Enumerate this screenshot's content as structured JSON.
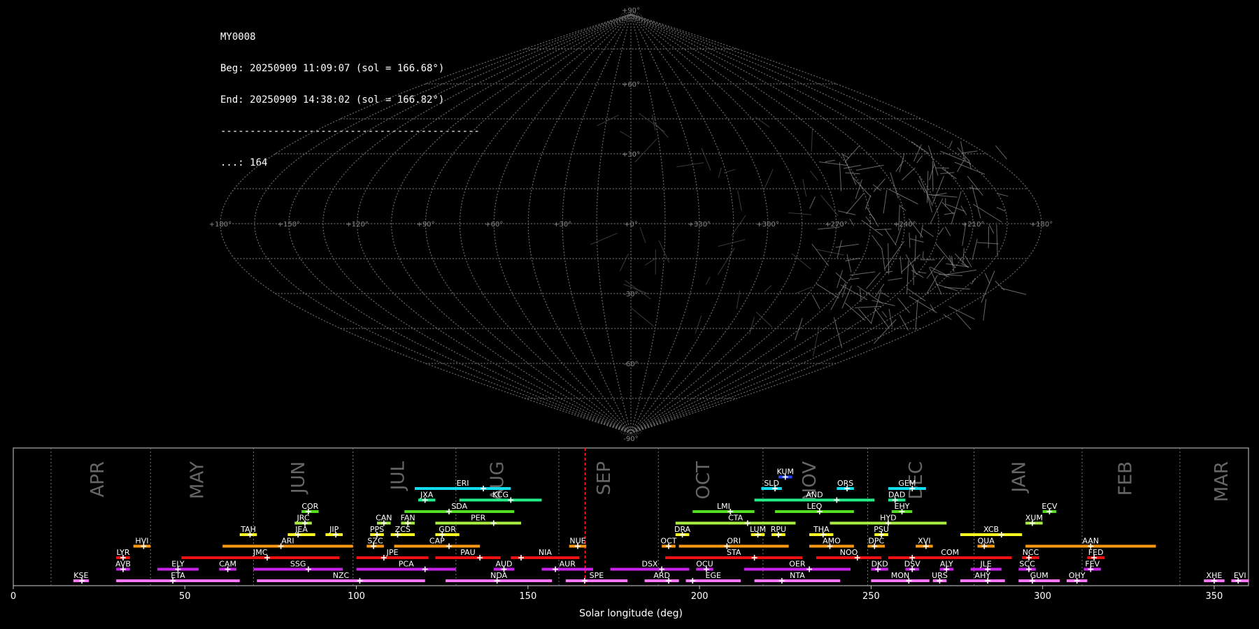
{
  "header": {
    "id_line": "MY0008",
    "begin_line": "Beg: 20250909 11:09:07 (sol = 166.68°)",
    "end_line": "End: 20250909 14:38:02 (sol = 166.82°)",
    "separator": "--------------------------------------------",
    "count_line": "...: 164"
  },
  "chart_data": [
    {
      "type": "scatter",
      "projection": "sinusoidal (all-sky)",
      "grid": true,
      "longitude_labels": [
        "+180°",
        "+150°",
        "+120°",
        "+90°",
        "+60°",
        "+30°",
        "+0°",
        "+330°",
        "+300°",
        "+270°",
        "+240°",
        "+210°",
        "+180°"
      ],
      "latitude_labels": [
        "+90°",
        "+60°",
        "+30°",
        "-30°",
        "-60°",
        "-90°"
      ],
      "description_of_marks": "short meteor trails concentrated around longitude 270°–210°",
      "colors": {
        "grid": "#666666",
        "trails": "#8a8a8a"
      }
    },
    {
      "type": "bar",
      "title": "",
      "xlabel": "Solar longitude (deg)",
      "xlim": [
        0,
        360
      ],
      "x_ticks": [
        0,
        50,
        100,
        150,
        200,
        250,
        300,
        350
      ],
      "current_sol": 166.68,
      "month_labels": [
        {
          "name": "APR",
          "sol": 24.5
        },
        {
          "name": "MAY",
          "sol": 53.5
        },
        {
          "name": "JUN",
          "sol": 83
        },
        {
          "name": "JUL",
          "sol": 112
        },
        {
          "name": "AUG",
          "sol": 141
        },
        {
          "name": "SEP",
          "sol": 172
        },
        {
          "name": "OCT",
          "sol": 201
        },
        {
          "name": "NOV",
          "sol": 232
        },
        {
          "name": "DEC",
          "sol": 263
        },
        {
          "name": "JAN",
          "sol": 293
        },
        {
          "name": "FEB",
          "sol": 324
        },
        {
          "name": "MAR",
          "sol": 352
        }
      ],
      "month_boundaries": [
        11,
        40,
        70,
        99,
        129,
        159,
        188,
        218.5,
        249,
        280,
        311.5,
        340
      ],
      "level_colors": [
        "#ff77ff",
        "#cc22ee",
        "#ee1111",
        "#ff9911",
        "#ffff22",
        "#aaee44",
        "#55dd22",
        "#22ee88",
        "#11ddee",
        "#2244ff"
      ],
      "showers": [
        {
          "code": "KSE",
          "start": 17.5,
          "end": 22,
          "peak": 20,
          "level": 0
        },
        {
          "code": "ETA",
          "start": 30,
          "end": 66,
          "peak": 46.5,
          "level": 0
        },
        {
          "code": "NZC",
          "start": 71,
          "end": 120,
          "peak": 101,
          "level": 0
        },
        {
          "code": "NDA",
          "start": 126,
          "end": 157,
          "peak": 141,
          "level": 0
        },
        {
          "code": "SPE",
          "start": 161,
          "end": 179,
          "peak": 166.5,
          "level": 0
        },
        {
          "code": "ARD",
          "start": 184,
          "end": 194,
          "peak": 191,
          "level": 0
        },
        {
          "code": "EGE",
          "start": 196,
          "end": 212,
          "peak": 198,
          "level": 0
        },
        {
          "code": "NTA",
          "start": 216,
          "end": 241,
          "peak": 224,
          "level": 0
        },
        {
          "code": "MON",
          "start": 250,
          "end": 267,
          "peak": 261,
          "level": 0
        },
        {
          "code": "URS",
          "start": 268,
          "end": 272,
          "peak": 270,
          "level": 0
        },
        {
          "code": "AHY",
          "start": 276,
          "end": 289,
          "peak": 284,
          "level": 0
        },
        {
          "code": "GUM",
          "start": 293,
          "end": 305,
          "peak": 297,
          "level": 0
        },
        {
          "code": "OHY",
          "start": 307,
          "end": 313,
          "peak": 310,
          "level": 0
        },
        {
          "code": "XHE",
          "start": 347,
          "end": 353,
          "peak": 350,
          "level": 0
        },
        {
          "code": "EVI",
          "start": 355,
          "end": 360,
          "peak": 357,
          "level": 0
        },
        {
          "code": "AVB",
          "start": 30,
          "end": 34,
          "peak": 32,
          "level": 1
        },
        {
          "code": "ELY",
          "start": 42,
          "end": 54,
          "peak": 48,
          "level": 1
        },
        {
          "code": "CAM",
          "start": 60,
          "end": 65,
          "peak": 62.5,
          "level": 1
        },
        {
          "code": "SSG",
          "start": 70,
          "end": 96,
          "peak": 86,
          "level": 1
        },
        {
          "code": "PCA",
          "start": 100,
          "end": 129,
          "peak": 120,
          "level": 1
        },
        {
          "code": "AUD",
          "start": 140,
          "end": 146,
          "peak": 143,
          "level": 1
        },
        {
          "code": "AUR",
          "start": 154,
          "end": 169,
          "peak": 158,
          "level": 1
        },
        {
          "code": "DSX",
          "start": 174,
          "end": 197,
          "peak": 189,
          "level": 1
        },
        {
          "code": "OCU",
          "start": 199,
          "end": 204,
          "peak": 202,
          "level": 1
        },
        {
          "code": "OER",
          "start": 213,
          "end": 244,
          "peak": 232,
          "level": 1
        },
        {
          "code": "DKD",
          "start": 250,
          "end": 255,
          "peak": 252,
          "level": 1
        },
        {
          "code": "DSV",
          "start": 260,
          "end": 264,
          "peak": 262,
          "level": 1
        },
        {
          "code": "ALY",
          "start": 270,
          "end": 274,
          "peak": 272,
          "level": 1
        },
        {
          "code": "JLE",
          "start": 279,
          "end": 288,
          "peak": 284,
          "level": 1
        },
        {
          "code": "SCC",
          "start": 293,
          "end": 298,
          "peak": 296,
          "level": 1
        },
        {
          "code": "FEV",
          "start": 312,
          "end": 317,
          "peak": 314,
          "level": 1
        },
        {
          "code": "LYR",
          "start": 30,
          "end": 34,
          "peak": 32,
          "level": 2
        },
        {
          "code": "JMC",
          "start": 49,
          "end": 95,
          "peak": 74,
          "level": 2
        },
        {
          "code": "JPE",
          "start": 100,
          "end": 121,
          "peak": 108,
          "level": 2
        },
        {
          "code": "PAU",
          "start": 123,
          "end": 142,
          "peak": 136,
          "level": 2
        },
        {
          "code": "NIA",
          "start": 145,
          "end": 165,
          "peak": 148,
          "level": 2
        },
        {
          "code": "STA",
          "start": 190,
          "end": 230,
          "peak": 216,
          "level": 2
        },
        {
          "code": "NOO",
          "start": 234,
          "end": 253,
          "peak": 246,
          "level": 2
        },
        {
          "code": "COM",
          "start": 255,
          "end": 291,
          "peak": 262,
          "level": 2
        },
        {
          "code": "NCC",
          "start": 294,
          "end": 299,
          "peak": 296,
          "level": 2
        },
        {
          "code": "FED",
          "start": 313,
          "end": 318,
          "peak": 315,
          "level": 2
        },
        {
          "code": "HVI",
          "start": 35,
          "end": 40,
          "peak": 38,
          "level": 3
        },
        {
          "code": "ARI",
          "start": 61,
          "end": 99,
          "peak": 78,
          "level": 3
        },
        {
          "code": "SZC",
          "start": 103,
          "end": 108,
          "peak": 105,
          "level": 3
        },
        {
          "code": "CAP",
          "start": 111,
          "end": 136,
          "peak": 127,
          "level": 3
        },
        {
          "code": "NUE",
          "start": 162,
          "end": 167,
          "peak": 164.5,
          "level": 3
        },
        {
          "code": "OCT",
          "start": 189,
          "end": 193,
          "peak": 191,
          "level": 3
        },
        {
          "code": "ORI",
          "start": 194,
          "end": 226,
          "peak": 208,
          "level": 3
        },
        {
          "code": "AMO",
          "start": 232,
          "end": 245,
          "peak": 238,
          "level": 3
        },
        {
          "code": "DPC",
          "start": 249,
          "end": 254,
          "peak": 251,
          "level": 3
        },
        {
          "code": "XVI",
          "start": 263,
          "end": 268,
          "peak": 266,
          "level": 3
        },
        {
          "code": "QUA",
          "start": 281,
          "end": 286,
          "peak": 283,
          "level": 3
        },
        {
          "code": "AAN",
          "start": 295,
          "end": 333,
          "peak": 314,
          "level": 3
        },
        {
          "code": "TAH",
          "start": 66,
          "end": 71,
          "peak": 69,
          "level": 4
        },
        {
          "code": "JEA",
          "start": 80,
          "end": 88,
          "peak": 83,
          "level": 4
        },
        {
          "code": "JIP",
          "start": 91,
          "end": 96,
          "peak": 94,
          "level": 4
        },
        {
          "code": "PPS",
          "start": 104,
          "end": 108,
          "peak": 106,
          "level": 4
        },
        {
          "code": "ZCS",
          "start": 110,
          "end": 117,
          "peak": 112,
          "level": 4
        },
        {
          "code": "GDR",
          "start": 123,
          "end": 130,
          "peak": 125,
          "level": 4
        },
        {
          "code": "DRA",
          "start": 193,
          "end": 197,
          "peak": 195,
          "level": 4
        },
        {
          "code": "LUM",
          "start": 215,
          "end": 219,
          "peak": 217,
          "level": 4
        },
        {
          "code": "RPU",
          "start": 221,
          "end": 225,
          "peak": 223,
          "level": 4
        },
        {
          "code": "THA",
          "start": 232,
          "end": 239,
          "peak": 236,
          "level": 4
        },
        {
          "code": "PSU",
          "start": 251,
          "end": 255,
          "peak": 253,
          "level": 4
        },
        {
          "code": "XCB",
          "start": 276,
          "end": 294,
          "peak": 288,
          "level": 4
        },
        {
          "code": "JRC",
          "start": 82,
          "end": 87,
          "peak": 85,
          "level": 5
        },
        {
          "code": "CAN",
          "start": 106,
          "end": 110,
          "peak": 108,
          "level": 5
        },
        {
          "code": "FAN",
          "start": 113,
          "end": 117,
          "peak": 115,
          "level": 5
        },
        {
          "code": "PER",
          "start": 123,
          "end": 148,
          "peak": 140,
          "level": 5
        },
        {
          "code": "CTA",
          "start": 193,
          "end": 228,
          "peak": 214,
          "level": 5
        },
        {
          "code": "HYD",
          "start": 238,
          "end": 272,
          "peak": 255,
          "level": 5
        },
        {
          "code": "XUM",
          "start": 295,
          "end": 300,
          "peak": 297,
          "level": 5
        },
        {
          "code": "COR",
          "start": 84,
          "end": 89,
          "peak": 86,
          "level": 6
        },
        {
          "code": "SDA",
          "start": 114,
          "end": 146,
          "peak": 127,
          "level": 6
        },
        {
          "code": "LMI",
          "start": 198,
          "end": 216,
          "peak": 209,
          "level": 6
        },
        {
          "code": "LEO",
          "start": 222,
          "end": 245,
          "peak": 235,
          "level": 6
        },
        {
          "code": "EHY",
          "start": 256,
          "end": 262,
          "peak": 259,
          "level": 6
        },
        {
          "code": "ECV",
          "start": 300,
          "end": 304,
          "peak": 302,
          "level": 6
        },
        {
          "code": "JXA",
          "start": 118,
          "end": 123,
          "peak": 120,
          "level": 7
        },
        {
          "code": "KCG",
          "start": 130,
          "end": 154,
          "peak": 145,
          "level": 7
        },
        {
          "code": "AND",
          "start": 216,
          "end": 251,
          "peak": 240,
          "level": 7
        },
        {
          "code": "DAD",
          "start": 255,
          "end": 260,
          "peak": 257,
          "level": 7
        },
        {
          "code": "ERI",
          "start": 117,
          "end": 145,
          "peak": 137,
          "level": 8
        },
        {
          "code": "SLD",
          "start": 218,
          "end": 224,
          "peak": 222,
          "level": 8
        },
        {
          "code": "ORS",
          "start": 240,
          "end": 245,
          "peak": 243,
          "level": 8
        },
        {
          "code": "GEM",
          "start": 255,
          "end": 266,
          "peak": 262,
          "level": 8
        },
        {
          "code": "KUM",
          "start": 223,
          "end": 227,
          "peak": 225,
          "level": 9
        }
      ]
    }
  ]
}
